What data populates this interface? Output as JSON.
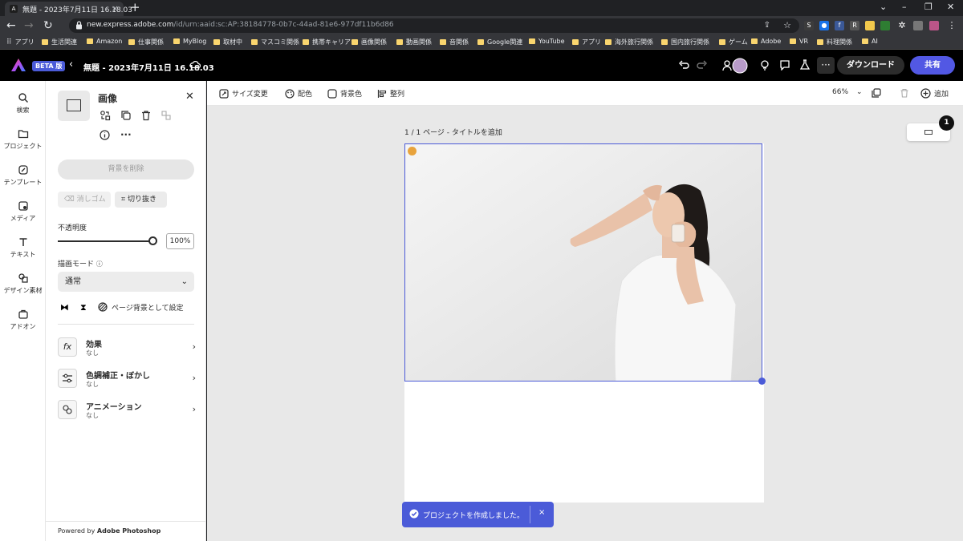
{
  "browser": {
    "tab_title": "無題 - 2023年7月11日 16.18.03",
    "tab_close": "×",
    "new_tab": "+",
    "url_host": "new.express.adobe.com",
    "url_path": "/id/urn:aaid:sc:AP:38184778-0b7c-44ad-81e6-977df11b6d86",
    "window_controls": [
      "⌄",
      "–",
      "❐",
      "✕"
    ]
  },
  "bookmarks": [
    "アプリ",
    "生活関連",
    "Amazon",
    "仕事関係",
    "MyBlog",
    "取材中",
    "マスコミ関係",
    "携帯キャリア",
    "画像関係",
    "動画関係",
    "音関係",
    "Google関連",
    "YouTube",
    "アプリ",
    "海外旅行関係",
    "国内旅行関係",
    "ゲーム",
    "Adobe",
    "VR",
    "料理関係",
    "AI"
  ],
  "app": {
    "beta_label": "BETA 版",
    "doc_title": "無題 - 2023年7月11日 16.18.03",
    "download_label": "ダウンロード",
    "share_label": "共有",
    "accent": "#5258e4"
  },
  "rail": [
    {
      "label": "検索",
      "icon": "search-icon"
    },
    {
      "label": "プロジェクト",
      "icon": "folder-icon"
    },
    {
      "label": "テンプレート",
      "icon": "template-icon"
    },
    {
      "label": "メディア",
      "icon": "media-icon"
    },
    {
      "label": "テキスト",
      "icon": "text-icon"
    },
    {
      "label": "デザイン素材",
      "icon": "shapes-icon"
    },
    {
      "label": "アドオン",
      "icon": "addon-icon"
    }
  ],
  "panel": {
    "title": "画像",
    "close": "✕",
    "remove_bg": "背景を削除",
    "eraser": "消しゴム",
    "crop": "切り抜き",
    "opacity_label": "不透明度",
    "opacity_value": "100%",
    "opacity_fraction": 1.0,
    "blend_label": "描画モード",
    "blend_value": "通常",
    "page_bg": "ページ背景として設定",
    "rows": [
      {
        "title": "効果",
        "sub": "なし",
        "icon": "fx"
      },
      {
        "title": "色調補正・ぼかし",
        "sub": "なし",
        "icon": "sliders"
      },
      {
        "title": "アニメーション",
        "sub": "なし",
        "icon": "anim"
      }
    ],
    "powered_prefix": "Powered by ",
    "powered_brand": "Adobe Photoshop"
  },
  "toolbar": {
    "resize": "サイズ変更",
    "color": "配色",
    "bgcolor": "背景色",
    "align": "整列",
    "zoom": "66%",
    "add": "追加"
  },
  "canvas": {
    "page_label": "1 / 1 ページ - タイトルを追加",
    "page_count": "1"
  },
  "toast": {
    "message": "プロジェクトを作成しました。",
    "close": "×"
  }
}
